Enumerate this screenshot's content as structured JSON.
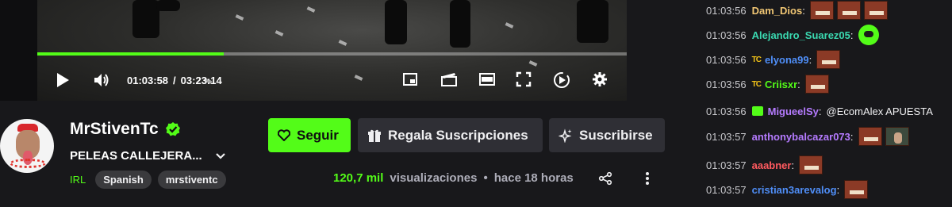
{
  "player": {
    "current_time": "01:03:58",
    "separator": "/",
    "duration": "03:23:14",
    "progress_fraction": 0.3158
  },
  "channel": {
    "name": "MrStivenTc",
    "stream_title": "PELEAS CALLEJERA...",
    "category": "IRL",
    "tags": [
      "Spanish",
      "mrstiventc"
    ],
    "views_count": "120,7 mil",
    "views_label": "visualizaciones",
    "time_ago": "hace 18 horas"
  },
  "buttons": {
    "follow": "Seguir",
    "gift": "Regala Suscripciones",
    "subscribe": "Suscribirse"
  },
  "chat": [
    {
      "time": "01:03:56",
      "user": "Dam_Dios",
      "color": "#f0c674",
      "emotes": 3
    },
    {
      "time": "01:03:56",
      "user": "Alejandro_Suarez05",
      "color": "#3ad8b0",
      "emotes": 0,
      "green_emote": true
    },
    {
      "time": "01:03:56",
      "user": "elyona99",
      "color": "#4f8ef7",
      "badge": "TC",
      "emotes": 1
    },
    {
      "time": "01:03:56",
      "user": "Criisxr",
      "color": "#53fc18",
      "badge": "TC",
      "emotes": 1
    },
    {
      "time": "01:03:56",
      "user": "MigueelSy",
      "color": "#b57bff",
      "gift_badge": true,
      "text": "@EcomAlex APUESTA"
    },
    {
      "time": "01:03:57",
      "user": "anthonybalcazar073",
      "color": "#b57bff",
      "emotes": 1,
      "face_emote": true
    },
    {
      "time": "01:03:57",
      "user": "aaabner",
      "color": "#ff5a5f",
      "emotes": 1
    },
    {
      "time": "01:03:57",
      "user": "cristian3arevalog",
      "color": "#4f8ef7",
      "emotes": 1
    }
  ],
  "colors": {
    "accent": "#53fc18",
    "background": "#18181b",
    "button_bg": "#2f2f35"
  },
  "icons": [
    "play-icon",
    "volume-icon",
    "pip-icon",
    "clip-icon",
    "theater-icon",
    "fullscreen-icon",
    "speed-icon",
    "settings-icon",
    "heart-icon",
    "gift-icon",
    "sparkle-icon",
    "share-icon",
    "more-icon",
    "chevron-down-icon",
    "verified-icon"
  ]
}
